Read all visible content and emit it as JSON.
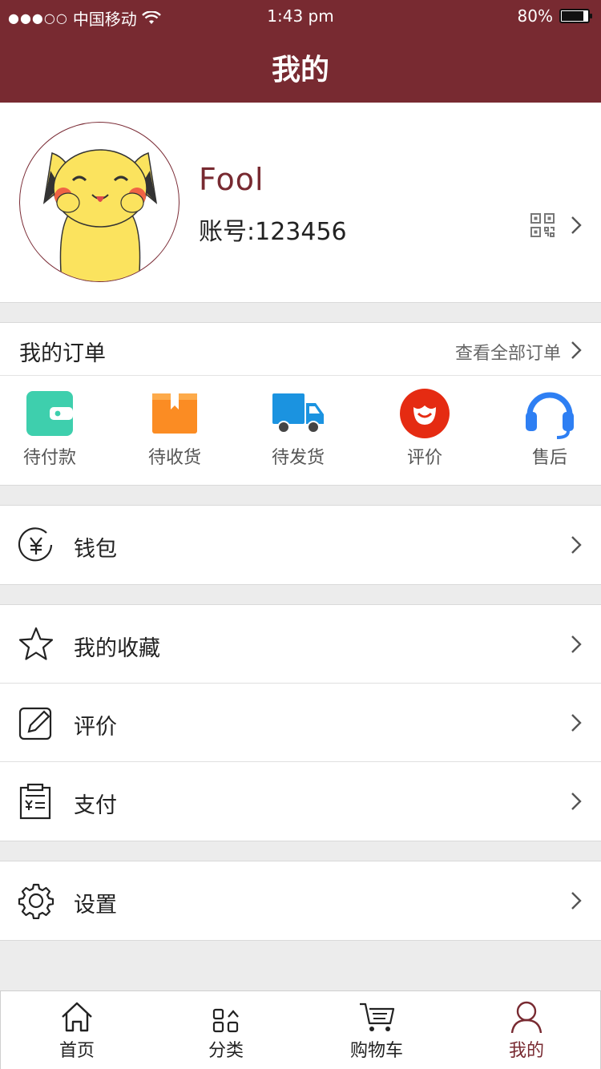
{
  "status_bar": {
    "signal": "●●●○○",
    "carrier": "中国移动",
    "time": "1:43 pm",
    "battery": "80%"
  },
  "header": {
    "title": "我的"
  },
  "profile": {
    "nickname": "Fool",
    "account": "账号:123456"
  },
  "orders": {
    "title": "我的订单",
    "view_all": "查看全部订单",
    "items": [
      {
        "label": "待付款",
        "icon": "wallet-icon",
        "color": "#3ecfad"
      },
      {
        "label": "待收货",
        "icon": "package-icon",
        "color": "#fb8c23"
      },
      {
        "label": "待发货",
        "icon": "truck-icon",
        "color": "#1b93e0"
      },
      {
        "label": "评价",
        "icon": "smile-icon",
        "color": "#e52b12"
      },
      {
        "label": "售后",
        "icon": "headset-icon",
        "color": "#2e7ff3"
      }
    ]
  },
  "menu": {
    "wallet": "钱包",
    "favorites": "我的收藏",
    "review": "评价",
    "payment": "支付",
    "settings": "设置"
  },
  "tabbar": {
    "items": [
      {
        "label": "首页",
        "icon": "home-icon"
      },
      {
        "label": "分类",
        "icon": "category-icon"
      },
      {
        "label": "购物车",
        "icon": "cart-icon"
      },
      {
        "label": "我的",
        "icon": "user-icon"
      }
    ],
    "active_index": 3,
    "active_color": "#782a31"
  },
  "colors": {
    "brand": "#782a31",
    "background": "#ececec"
  }
}
